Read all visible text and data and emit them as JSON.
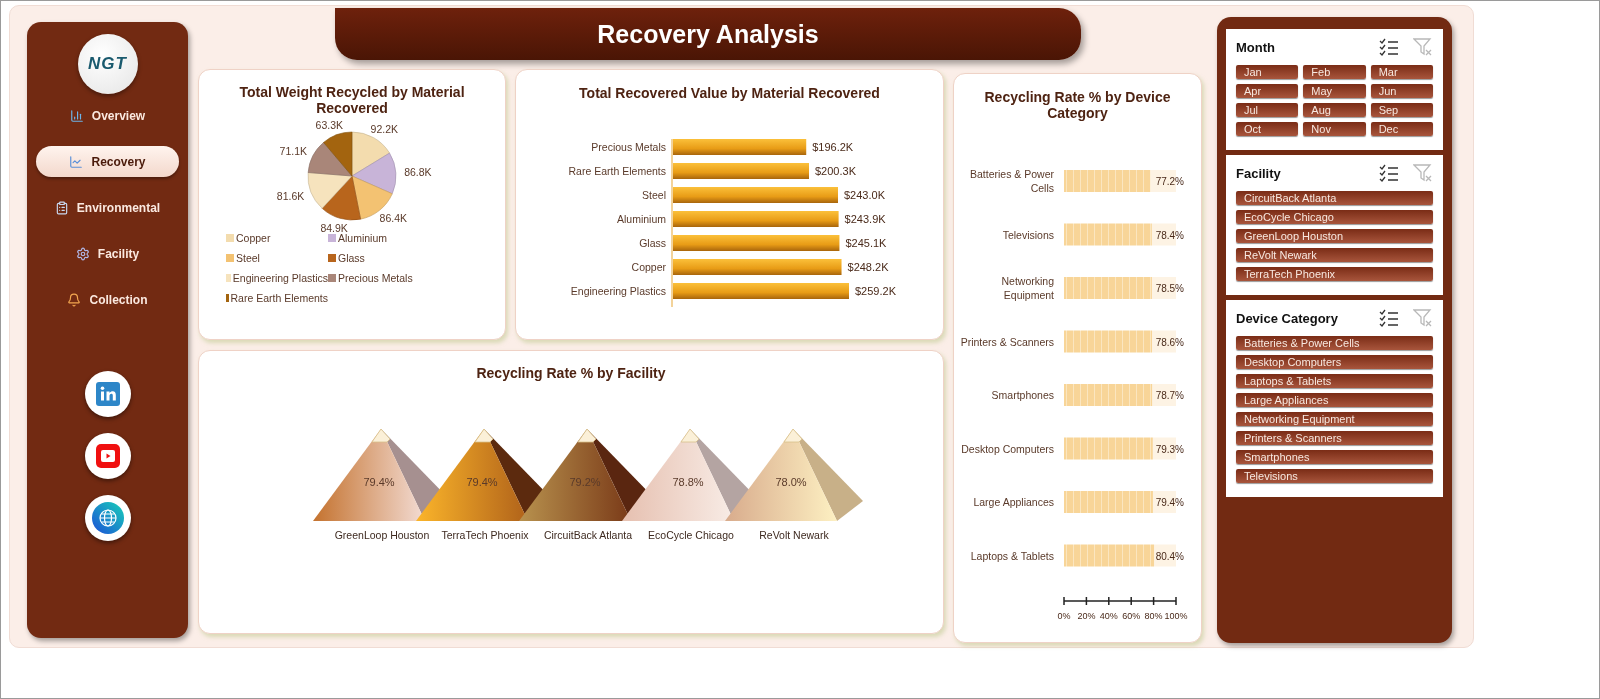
{
  "sidebar": {
    "logo": {
      "text": "NGT"
    },
    "nav": [
      {
        "label": "Overview",
        "selected": false
      },
      {
        "label": "Recovery",
        "selected": true
      },
      {
        "label": "Environmental",
        "selected": false
      },
      {
        "label": "Facility",
        "selected": false
      },
      {
        "label": "Collection",
        "selected": false
      }
    ]
  },
  "title": "Recovery Analysis",
  "weight_card": {
    "chart_data": {
      "type": "pie",
      "title": "Total Weight Recycled by Material Recovered",
      "categories": [
        "Copper",
        "Aluminium",
        "Steel",
        "Glass",
        "Engineering Plastics",
        "Precious Metals",
        "Rare Earth Elements"
      ],
      "values": [
        92.2,
        86.8,
        86.4,
        84.9,
        81.6,
        71.1,
        63.3
      ],
      "value_labels": [
        "92.2K",
        "86.8K",
        "86.4K",
        "84.9K",
        "81.6K",
        "71.1K",
        "63.3K"
      ],
      "colors": [
        "#f3dcae",
        "#c8b4d8",
        "#f3c272",
        "#b8651c",
        "#f6e3bd",
        "#a98679",
        "#a3640f"
      ]
    }
  },
  "value_card": {
    "chart_data": {
      "type": "bar",
      "orientation": "horizontal",
      "title": "Total Recovered Value by Material Recovered",
      "categories": [
        "Precious Metals",
        "Rare Earth Elements",
        "Steel",
        "Aluminium",
        "Glass",
        "Copper",
        "Engineering Plastics"
      ],
      "values": [
        196.2,
        200.3,
        243.0,
        243.9,
        245.1,
        248.2,
        259.2
      ],
      "value_labels": [
        "$196.2K",
        "$200.3K",
        "$243.0K",
        "$243.9K",
        "$245.1K",
        "$248.2K",
        "$259.2K"
      ]
    }
  },
  "device_card": {
    "chart_data": {
      "type": "bar",
      "orientation": "horizontal",
      "title": "Recycling Rate % by Device Category",
      "categories": [
        "Batteries & Power Cells",
        "Televisions",
        "Networking Equipment",
        "Printers & Scanners",
        "Smartphones",
        "Desktop Computers",
        "Large Appliances",
        "Laptops & Tablets"
      ],
      "values": [
        77.2,
        78.4,
        78.5,
        78.6,
        78.7,
        79.3,
        79.4,
        80.4
      ],
      "value_labels": [
        "77.2%",
        "78.4%",
        "78.5%",
        "78.6%",
        "78.7%",
        "79.3%",
        "79.4%",
        "80.4%"
      ],
      "xlim": [
        0,
        100
      ],
      "xticks": [
        {
          "value": 0,
          "label": "0%"
        },
        {
          "value": 20,
          "label": "20%"
        },
        {
          "value": 40,
          "label": "40%"
        },
        {
          "value": 60,
          "label": "60%"
        },
        {
          "value": 80,
          "label": "80%"
        },
        {
          "value": 100,
          "label": "100%"
        }
      ]
    }
  },
  "facility_card": {
    "title": "Recycling Rate % by Facility",
    "pyramids": [
      {
        "label": "GreenLoop Houston",
        "reading": "79.4%"
      },
      {
        "label": "TerraTech Phoenix",
        "reading": "79.4%"
      },
      {
        "label": "CircuitBack Atlanta",
        "reading": "79.2%"
      },
      {
        "label": "EcoCycle Chicago",
        "reading": "78.8%"
      },
      {
        "label": "ReVolt Newark",
        "reading": "78.0%"
      }
    ]
  },
  "slicers": [
    {
      "title": "Month",
      "kind": "grid",
      "items": [
        {
          "label": "Jan",
          "selected": true
        },
        {
          "label": "Feb",
          "selected": true
        },
        {
          "label": "Mar",
          "selected": true
        },
        {
          "label": "Apr",
          "selected": true
        },
        {
          "label": "May",
          "selected": true
        },
        {
          "label": "Jun",
          "selected": true
        },
        {
          "label": "Jul",
          "selected": true
        },
        {
          "label": "Aug",
          "selected": true
        },
        {
          "label": "Sep",
          "selected": true
        },
        {
          "label": "Oct",
          "selected": true
        },
        {
          "label": "Nov",
          "selected": true
        },
        {
          "label": "Dec",
          "selected": true
        }
      ]
    },
    {
      "title": "Facility",
      "kind": "list",
      "items": [
        {
          "label": "CircuitBack Atlanta",
          "selected": true
        },
        {
          "label": "EcoCycle Chicago",
          "selected": true
        },
        {
          "label": "GreenLoop Houston",
          "selected": true
        },
        {
          "label": "ReVolt Newark",
          "selected": true
        },
        {
          "label": "TerraTech Phoenix",
          "selected": true
        }
      ]
    },
    {
      "title": "Device Category",
      "kind": "list",
      "items": [
        {
          "label": "Batteries & Power Cells",
          "selected": true
        },
        {
          "label": "Desktop Computers",
          "selected": true
        },
        {
          "label": "Laptops & Tablets",
          "selected": true
        },
        {
          "label": "Large Appliances",
          "selected": true
        },
        {
          "label": "Networking Equipment",
          "selected": true
        },
        {
          "label": "Printers & Scanners",
          "selected": true
        },
        {
          "label": "Smartphones",
          "selected": true
        },
        {
          "label": "Televisions",
          "selected": true
        }
      ]
    }
  ]
}
